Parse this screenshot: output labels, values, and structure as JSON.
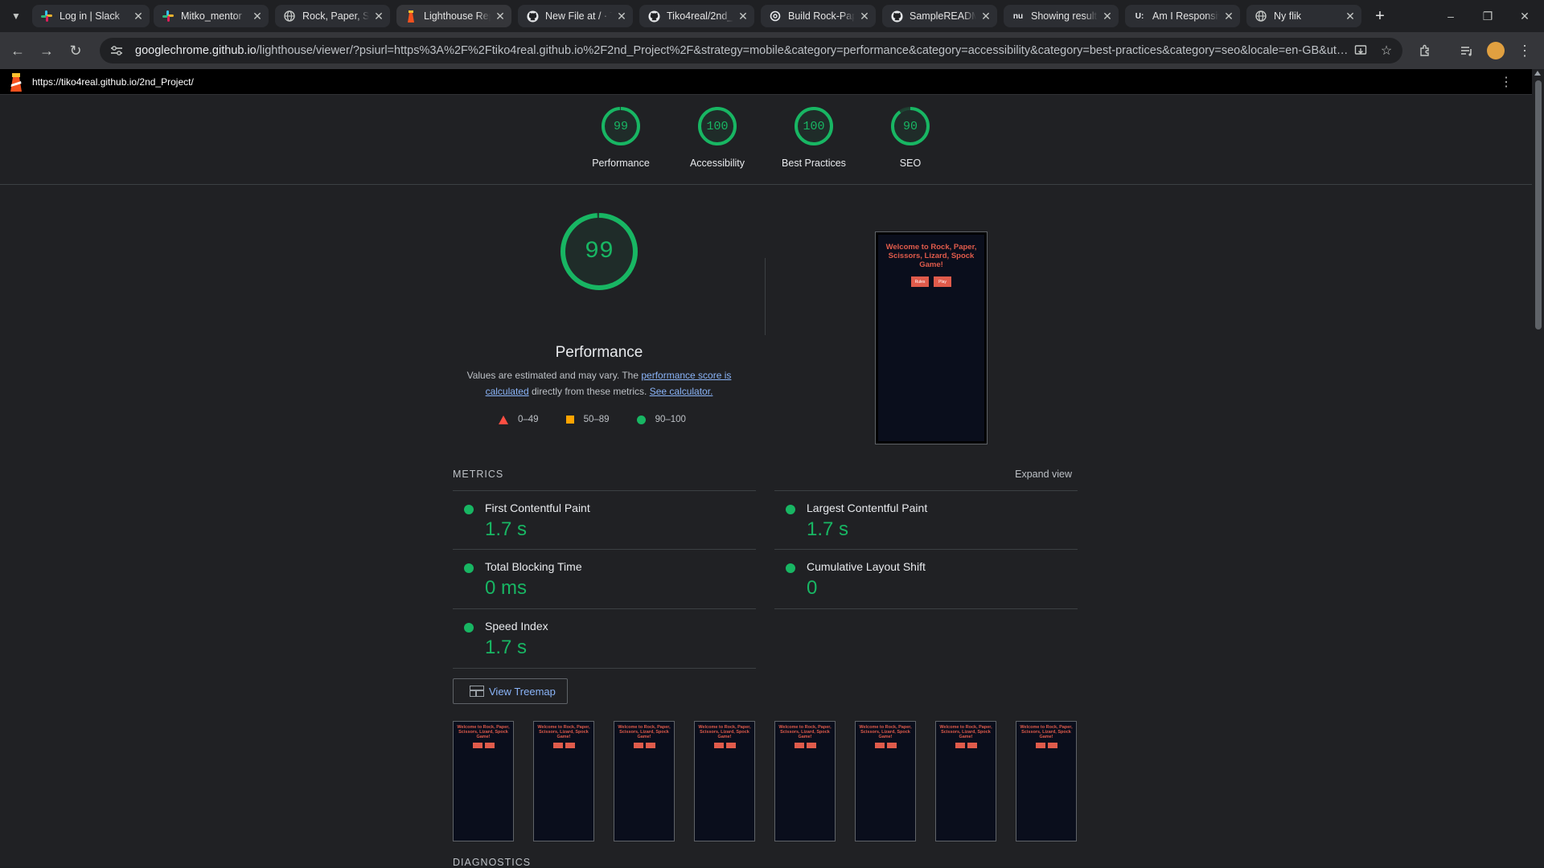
{
  "browser": {
    "tabs": [
      {
        "title": "Log in | Slack",
        "icon": "slack-icon"
      },
      {
        "title": "Mitko_mentor",
        "icon": "slack-icon"
      },
      {
        "title": "Rock, Paper, Sc",
        "icon": "globe-icon"
      },
      {
        "title": "Lighthouse Rep",
        "icon": "lighthouse-icon",
        "active": true
      },
      {
        "title": "New File at / · T",
        "icon": "github-icon"
      },
      {
        "title": "Tiko4real/2nd_",
        "icon": "github-icon"
      },
      {
        "title": "Build Rock-Pap",
        "icon": "openai-icon"
      },
      {
        "title": "SampleREADM",
        "icon": "github-icon"
      },
      {
        "title": "Showing result",
        "icon": "nu-icon"
      },
      {
        "title": "Am I Responsiv",
        "icon": "u-icon"
      },
      {
        "title": "Ny flik",
        "icon": "globe-icon"
      }
    ],
    "url_host": "googlechrome.github.io",
    "url_rest": "/lighthouse/viewer/?psiurl=https%3A%2F%2Ftiko4real.github.io%2F2nd_Project%2F&strategy=mobile&category=performance&category=accessibility&category=best-practices&category=seo&locale=en-GB&utm_sourc..."
  },
  "lighthouse": {
    "report_url": "https://tiko4real.github.io/2nd_Project/",
    "summary": [
      {
        "score": "99",
        "label": "Performance",
        "value": 0.99
      },
      {
        "score": "100",
        "label": "Accessibility",
        "value": 1.0
      },
      {
        "score": "100",
        "label": "Best Practices",
        "value": 1.0
      },
      {
        "score": "90",
        "label": "SEO",
        "value": 0.9
      }
    ],
    "performance": {
      "score": "99",
      "value": 0.99,
      "title": "Performance",
      "desc_pre": "Values are estimated and may vary. The ",
      "desc_link1": "performance score is calculated",
      "desc_mid": " directly from these metrics. ",
      "desc_link2": "See calculator."
    },
    "legend": {
      "fail": "0–49",
      "average": "50–89",
      "pass": "90–100"
    },
    "colors": {
      "pass": "#18b663",
      "average": "#ffa400",
      "fail": "#ff4e42",
      "link": "#8ab4f8"
    },
    "screenshot": {
      "title": "Welcome to Rock, Paper, Scissors, Lizard, Spock Game!",
      "btn1": "Rules",
      "btn2": "Play"
    },
    "metrics_label": "METRICS",
    "expand_label": "Expand view",
    "metrics": [
      {
        "name": "First Contentful Paint",
        "value": "1.7 s"
      },
      {
        "name": "Largest Contentful Paint",
        "value": "1.7 s"
      },
      {
        "name": "Total Blocking Time",
        "value": "0 ms"
      },
      {
        "name": "Cumulative Layout Shift",
        "value": "0"
      },
      {
        "name": "Speed Index",
        "value": "1.7 s"
      }
    ],
    "treemap_label": "View Treemap",
    "filmstrip_frame_text": "Welcome to Rock, Paper, Scissors, Lizard, Spock Game!",
    "diagnostics_label": "DIAGNOSTICS"
  }
}
